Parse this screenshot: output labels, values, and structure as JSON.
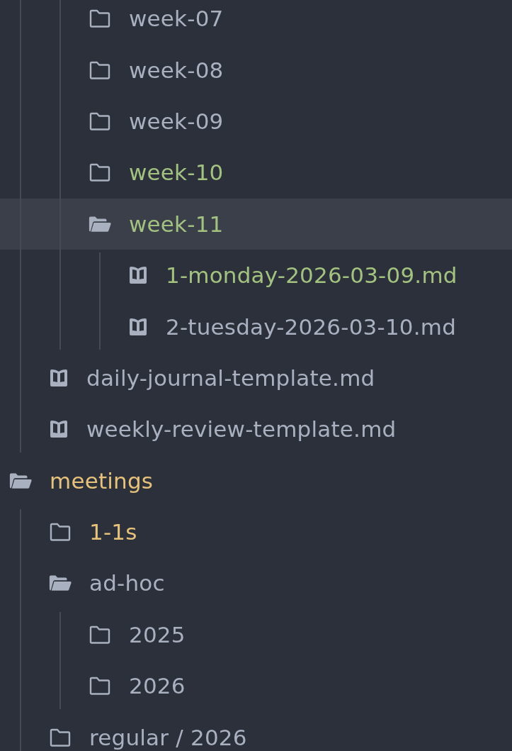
{
  "tree": [
    {
      "children": [
        {
          "children": [
            {
              "kind": "folder",
              "name": "week-07",
              "expanded": false,
              "selected": false,
              "color": "#a9b1c0"
            },
            {
              "kind": "folder",
              "name": "week-08",
              "expanded": false,
              "selected": false,
              "color": "#a9b1c0"
            },
            {
              "kind": "folder",
              "name": "week-09",
              "expanded": false,
              "selected": false,
              "color": "#a9b1c0"
            },
            {
              "kind": "folder",
              "name": "week-10",
              "expanded": false,
              "selected": false,
              "color": "#a3c27f"
            },
            {
              "kind": "folder",
              "name": "week-11",
              "expanded": true,
              "selected": true,
              "color": "#a3c27f",
              "children": [
                {
                  "kind": "file",
                  "name": "1-monday-2026-03-09.md",
                  "selected": false,
                  "color": "#a3c27f"
                },
                {
                  "kind": "file",
                  "name": "2-tuesday-2026-03-10.md",
                  "selected": false,
                  "color": "#a9b1c0"
                }
              ]
            }
          ]
        },
        {
          "kind": "file",
          "name": "daily-journal-template.md",
          "selected": false,
          "color": "#a9b1c0"
        },
        {
          "kind": "file",
          "name": "weekly-review-template.md",
          "selected": false,
          "color": "#a9b1c0"
        }
      ]
    },
    {
      "kind": "folder",
      "name": "meetings",
      "expanded": true,
      "selected": false,
      "color": "#e6c27a",
      "children": [
        {
          "kind": "folder",
          "name": "1-1s",
          "expanded": false,
          "selected": false,
          "color": "#e6c27a"
        },
        {
          "kind": "folder",
          "name": "ad-hoc",
          "expanded": true,
          "selected": false,
          "color": "#a9b1c0",
          "children": [
            {
              "kind": "folder",
              "name": "2025",
              "expanded": false,
              "selected": false,
              "color": "#a9b1c0"
            },
            {
              "kind": "folder",
              "name": "2026",
              "expanded": false,
              "selected": false,
              "color": "#a9b1c0"
            }
          ]
        },
        {
          "kind": "folder",
          "name": "regular / 2026",
          "expanded": false,
          "selected": false,
          "color": "#a9b1c0"
        }
      ]
    }
  ]
}
